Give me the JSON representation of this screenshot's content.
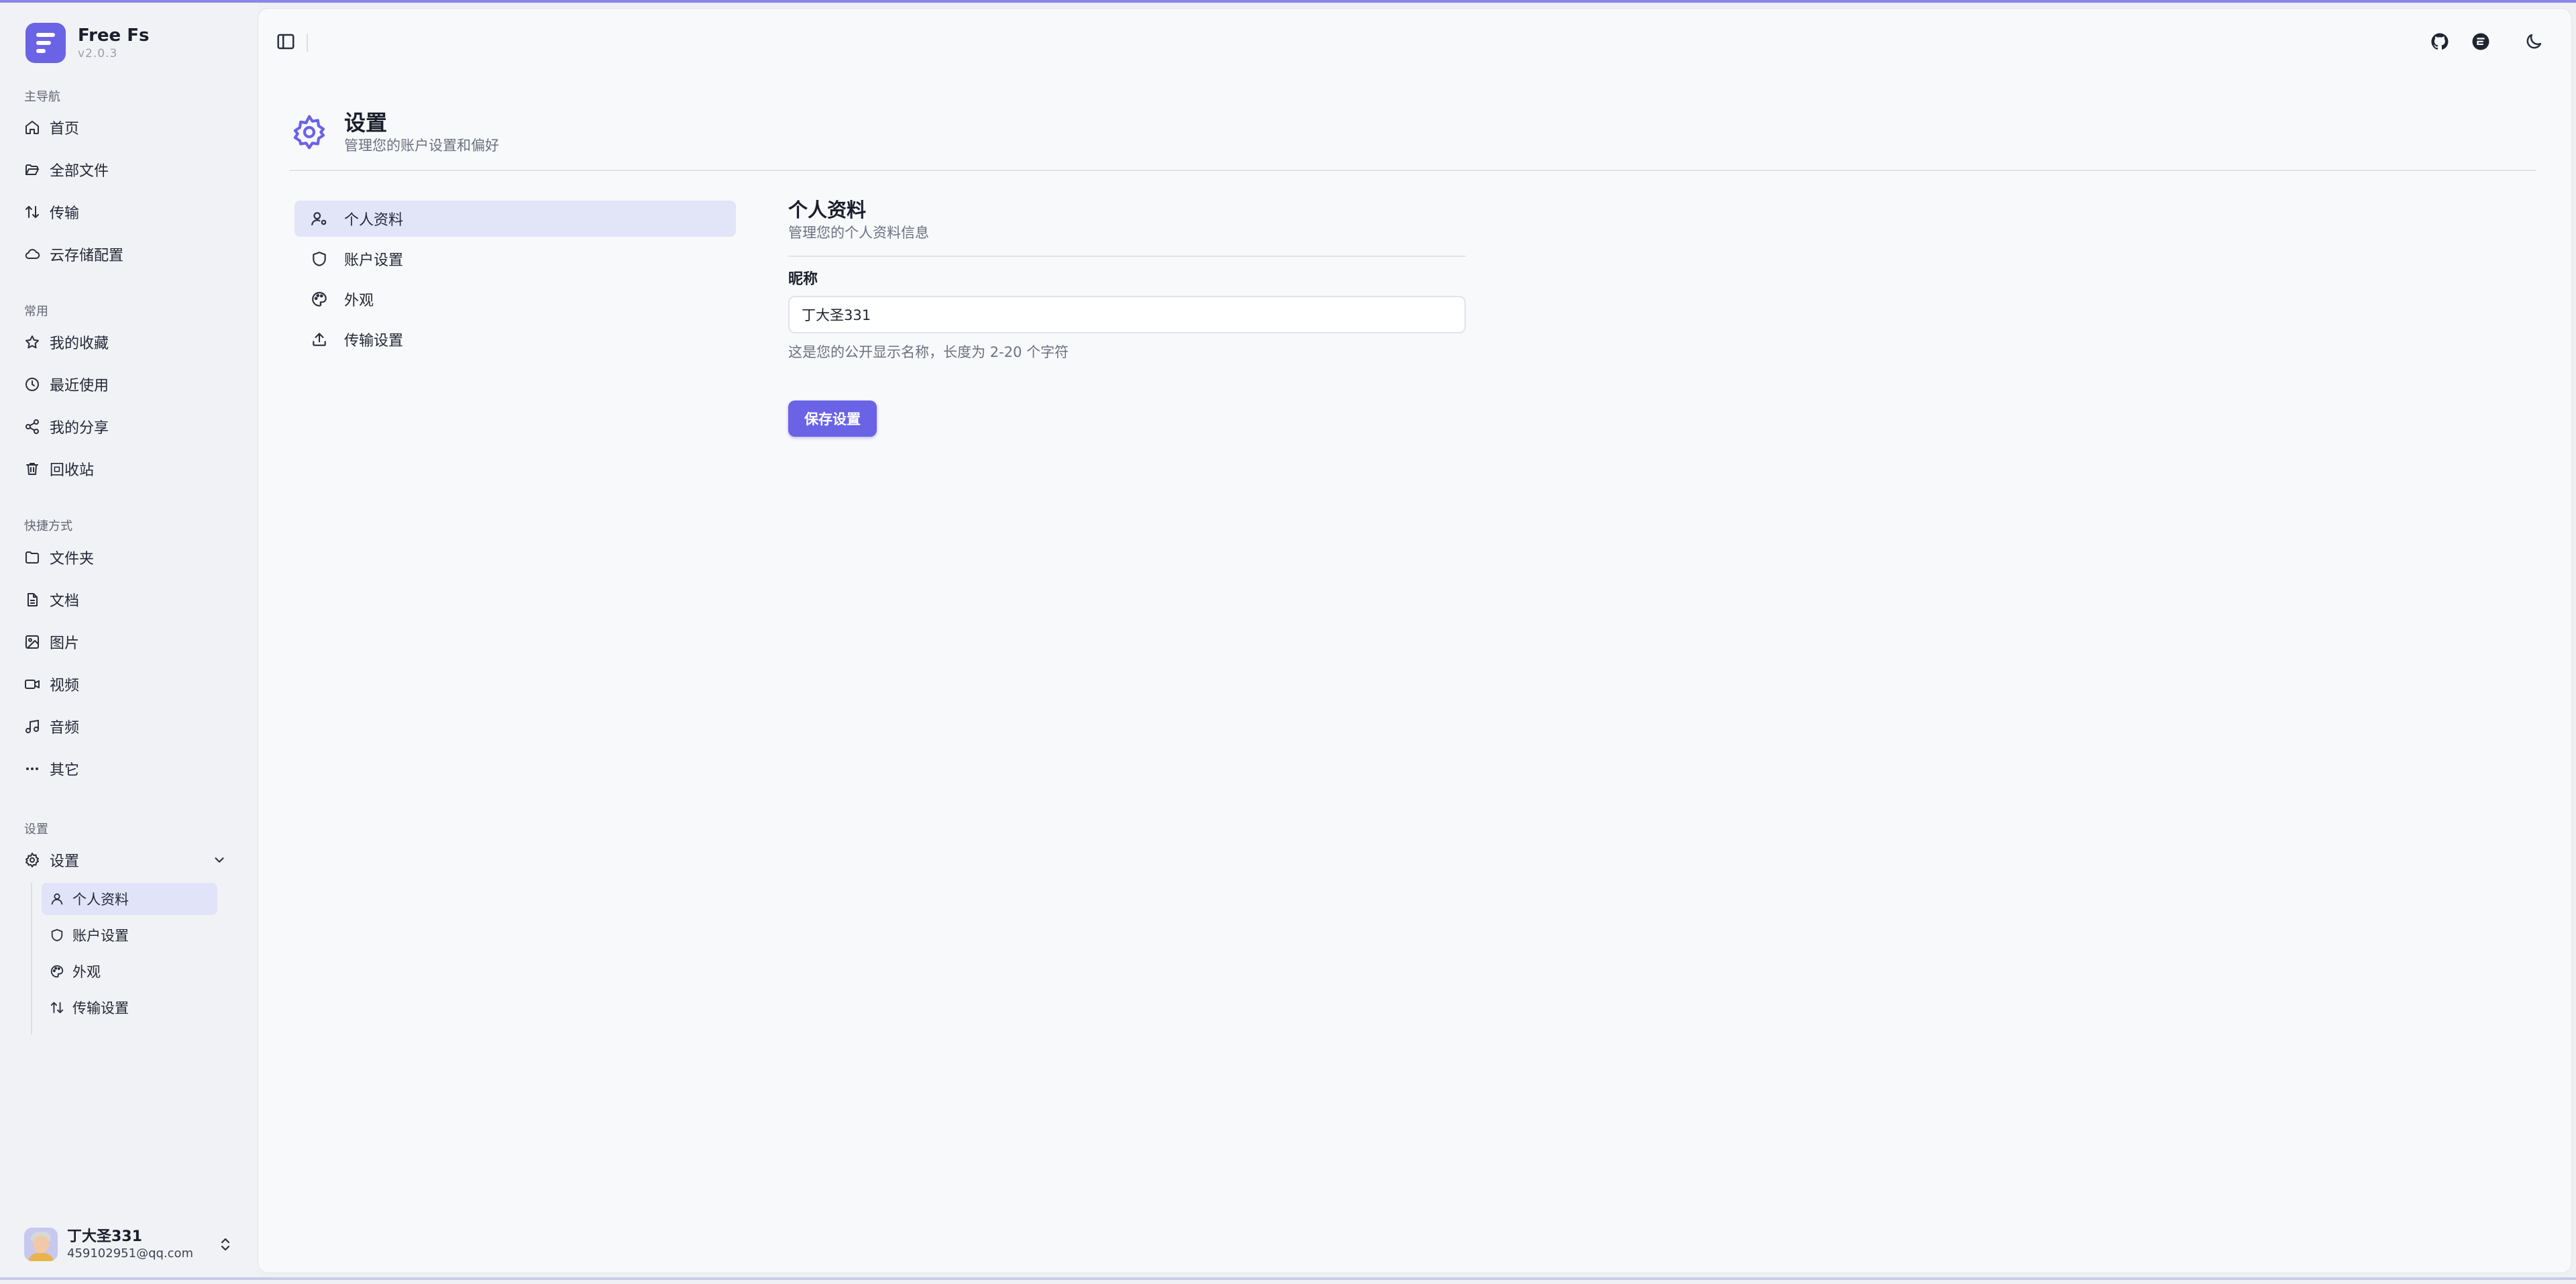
{
  "app": {
    "name": "Free Fs",
    "version": "v2.0.3"
  },
  "sidebar": {
    "sections": {
      "main": "主导航",
      "common": "常用",
      "shortcuts": "快捷方式",
      "settings": "设置"
    },
    "main_items": [
      "首页",
      "全部文件",
      "传输",
      "云存储配置"
    ],
    "common_items": [
      "我的收藏",
      "最近使用",
      "我的分享",
      "回收站"
    ],
    "shortcut_items": [
      "文件夹",
      "文档",
      "图片",
      "视频",
      "音频",
      "其它"
    ],
    "settings_group": "设置",
    "settings_items": [
      "个人资料",
      "账户设置",
      "外观",
      "传输设置"
    ],
    "active_settings_item": "个人资料"
  },
  "user": {
    "name": "丁大圣331",
    "email": "459102951@qq.com"
  },
  "page": {
    "title": "设置",
    "subtitle": "管理您的账户设置和偏好",
    "menu": [
      "个人资料",
      "账户设置",
      "外观",
      "传输设置"
    ],
    "active_menu": "个人资料"
  },
  "profile": {
    "title": "个人资料",
    "subtitle": "管理您的个人资料信息",
    "nickname_label": "昵称",
    "nickname_value": "丁大圣331",
    "nickname_hint": "这是您的公开显示名称，长度为 2-20 个字符",
    "save_label": "保存设置"
  },
  "colors": {
    "accent": "#6a63e6",
    "active_bg": "#e2e5f8",
    "background": "#f8f9fb"
  },
  "icons": {
    "top_bar": [
      "sidebar-toggle-icon",
      "github-icon",
      "gitee-icon",
      "moon-icon"
    ]
  }
}
